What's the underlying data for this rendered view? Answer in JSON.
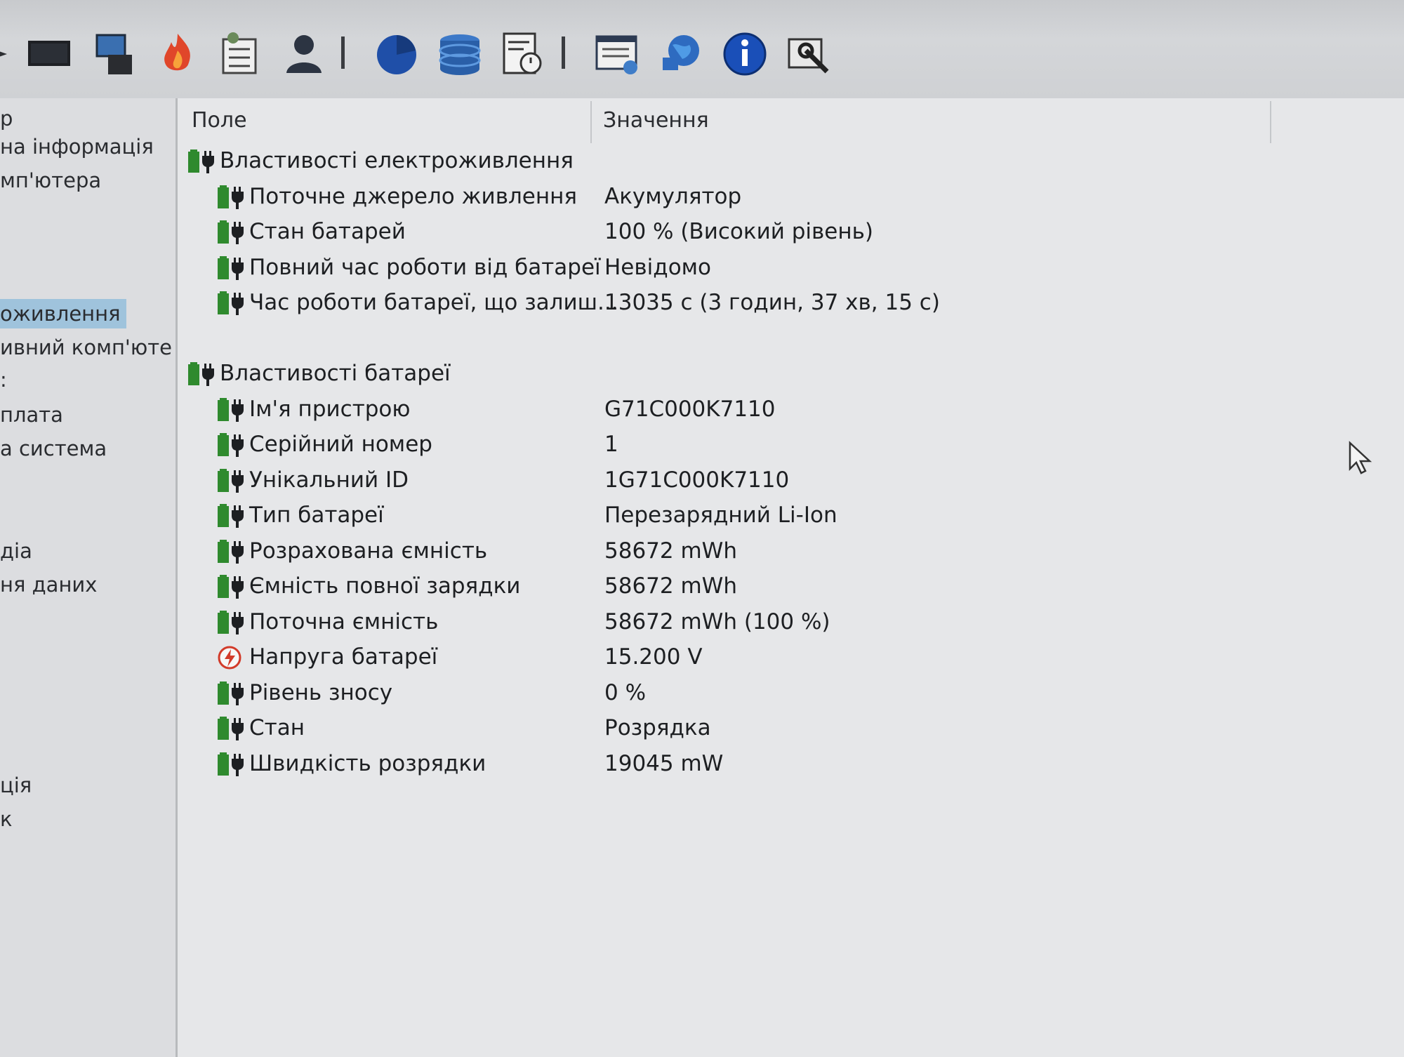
{
  "toolbar": {
    "icons": [
      "arrow-icon",
      "monitor-icon",
      "computer-icon",
      "flame-icon",
      "task-list-icon",
      "user-icon",
      "pie-chart-icon",
      "database-icon",
      "report-clock-icon",
      "report-icon",
      "network-globe-icon",
      "info-icon",
      "tools-icon"
    ]
  },
  "tree": {
    "items": [
      {
        "label": "р"
      },
      {
        "label": "на інформація"
      },
      {
        "label": "мп'ютера"
      },
      {
        "label": "оживлення",
        "selected": true
      },
      {
        "label": "ивний комп'юте"
      },
      {
        "label": ":"
      },
      {
        "label": "плата"
      },
      {
        "label": "а система"
      },
      {
        "label": "діа"
      },
      {
        "label": "ня даних"
      },
      {
        "label": "ція"
      },
      {
        "label": "к"
      }
    ]
  },
  "columns": {
    "field": "Поле",
    "value": "Значення"
  },
  "sections": [
    {
      "title": "Властивості електроживлення",
      "rows": [
        {
          "label": "Поточне джерело живлення",
          "value": "Акумулятор",
          "icon": "battery-plug-icon"
        },
        {
          "label": "Стан батарей",
          "value": "100 % (Високий рівень)",
          "icon": "battery-plug-icon"
        },
        {
          "label": "Повний час роботи від батареї",
          "value": "Невідомо",
          "icon": "battery-plug-icon"
        },
        {
          "label": "Час роботи батареї, що залиш...",
          "value": "13035 с (3 годин, 37 хв, 15 с)",
          "icon": "battery-plug-icon"
        }
      ]
    },
    {
      "title": "Властивості батареї",
      "rows": [
        {
          "label": "Ім'я пристрою",
          "value": "G71C000K7110",
          "icon": "battery-plug-icon"
        },
        {
          "label": "Серійний номер",
          "value": "1",
          "icon": "battery-plug-icon"
        },
        {
          "label": "Унікальний ID",
          "value": "1G71C000K7110",
          "icon": "battery-plug-icon"
        },
        {
          "label": "Тип батареї",
          "value": "Перезарядний Li-Ion",
          "icon": "battery-plug-icon"
        },
        {
          "label": "Розрахована ємність",
          "value": "58672 mWh",
          "icon": "battery-plug-icon"
        },
        {
          "label": "Ємність повної зарядки",
          "value": "58672 mWh",
          "icon": "battery-plug-icon"
        },
        {
          "label": "Поточна ємність",
          "value": "58672 mWh  (100 %)",
          "icon": "battery-plug-icon"
        },
        {
          "label": "Напруга батареї",
          "value": "15.200 V",
          "icon": "voltage-icon"
        },
        {
          "label": "Рівень зносу",
          "value": "0 %",
          "icon": "battery-plug-icon"
        },
        {
          "label": "Стан",
          "value": "Розрядка",
          "icon": "battery-plug-icon"
        },
        {
          "label": "Швидкість розрядки",
          "value": "19045 mW",
          "icon": "battery-plug-icon"
        }
      ]
    }
  ],
  "colors": {
    "battery": "#2f8a2e",
    "plug": "#1d1f22",
    "selection": "#9fc3dc",
    "voltage": "#d23b2a",
    "info": "#1a4fb8"
  }
}
